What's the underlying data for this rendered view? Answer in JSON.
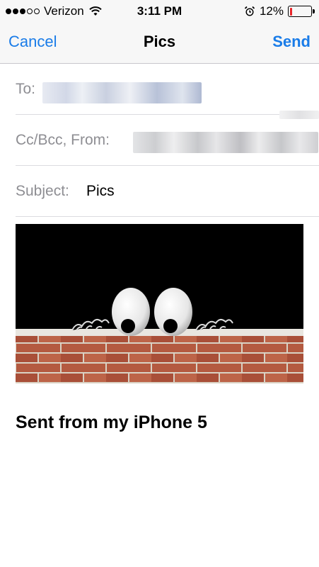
{
  "status_bar": {
    "carrier": "Verizon",
    "signal_strength": 3,
    "signal_max": 5,
    "time": "3:11 PM",
    "battery_percent": "12%",
    "battery_level": 0.12,
    "battery_color": "#e8272b",
    "icons": [
      "signal-dots-icon",
      "wifi-icon",
      "alarm-clock-icon",
      "battery-icon"
    ]
  },
  "nav": {
    "cancel_label": "Cancel",
    "title": "Pics",
    "send_label": "Send",
    "accent_color": "#1a7ce8"
  },
  "fields": {
    "to_label": "To:",
    "cc_label": "Cc/Bcc, From:",
    "subject_label": "Subject:",
    "subject_value": "Pics"
  },
  "attachment": {
    "description_icon": "googly-eyes-over-brick-wall-image"
  },
  "body": {
    "signature": "Sent from my iPhone 5"
  }
}
